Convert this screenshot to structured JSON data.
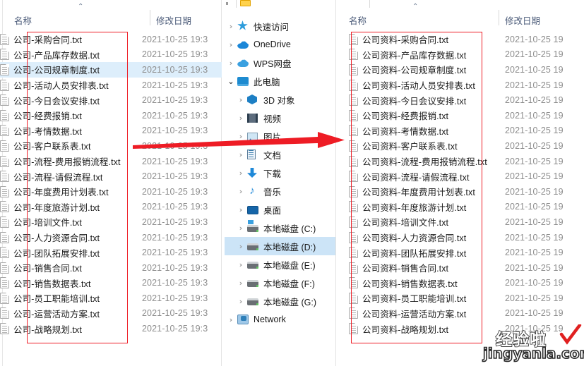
{
  "left_window": {
    "columns": {
      "name": "名称",
      "date": "修改日期",
      "sort_caret": "⌃"
    },
    "prefix": "公司-",
    "date_value": "2021-10-25 19:3",
    "selected_index": 2,
    "files": [
      "公司-采购合同.txt",
      "公司-产品库存数据.txt",
      "公司-公司规章制度.txt",
      "公司-活动人员安排表.txt",
      "公司-今日会议安排.txt",
      "公司-经费报销.txt",
      "公司-考情数据.txt",
      "公司-客户联系表.txt",
      "公司-流程-费用报销流程.txt",
      "公司-流程-请假流程.txt",
      "公司-年度费用计划表.txt",
      "公司-年度旅游计划.txt",
      "公司-培训文件.txt",
      "公司-人力资源合同.txt",
      "公司-团队拓展安排.txt",
      "公司-销售合同.txt",
      "公司-销售数据表.txt",
      "公司-员工职能培训.txt",
      "公司-运营活动方案.txt",
      "公司-战略规划.txt"
    ]
  },
  "right_window": {
    "columns": {
      "name": "名称",
      "date": "修改日期",
      "sort_caret": "⌃"
    },
    "prefix": "公司资料-",
    "date_value": "2021-10-25 19",
    "files": [
      "公司资料-采购合同.txt",
      "公司资料-产品库存数据.txt",
      "公司资料-公司规章制度.txt",
      "公司资料-活动人员安排表.txt",
      "公司资料-今日会议安排.txt",
      "公司资料-经费报销.txt",
      "公司资料-考情数据.txt",
      "公司资料-客户联系表.txt",
      "公司资料-流程-费用报销流程.txt",
      "公司资料-流程-请假流程.txt",
      "公司资料-年度费用计划表.txt",
      "公司资料-年度旅游计划.txt",
      "公司资料-培训文件.txt",
      "公司资料-人力资源合同.txt",
      "公司资料-团队拓展安排.txt",
      "公司资料-销售合同.txt",
      "公司资料-销售数据表.txt",
      "公司资料-员工职能培训.txt",
      "公司资料-运营活动方案.txt",
      "公司资料-战略规划.txt"
    ]
  },
  "nav_tree": {
    "selected_index": 12,
    "items": [
      {
        "label": "快速访问",
        "icon": "star-icon",
        "indent": 0,
        "chevron": "collapsed"
      },
      {
        "label": "OneDrive",
        "icon": "onedrive-cloud-icon",
        "indent": 0,
        "chevron": "collapsed"
      },
      {
        "label": "WPS网盘",
        "icon": "wps-cloud-icon",
        "indent": 0,
        "chevron": "collapsed"
      },
      {
        "label": "此电脑",
        "icon": "this-pc-icon",
        "indent": 0,
        "chevron": "expanded"
      },
      {
        "label": "3D 对象",
        "icon": "3d-objects-icon",
        "indent": 1,
        "chevron": "collapsed"
      },
      {
        "label": "视频",
        "icon": "videos-icon",
        "indent": 1,
        "chevron": "collapsed"
      },
      {
        "label": "图片",
        "icon": "pictures-icon",
        "indent": 1,
        "chevron": "collapsed"
      },
      {
        "label": "文档",
        "icon": "documents-icon",
        "indent": 1,
        "chevron": "collapsed"
      },
      {
        "label": "下载",
        "icon": "downloads-icon",
        "indent": 1,
        "chevron": "collapsed"
      },
      {
        "label": "音乐",
        "icon": "music-icon",
        "indent": 1,
        "chevron": "collapsed"
      },
      {
        "label": "桌面",
        "icon": "desktop-icon",
        "indent": 1,
        "chevron": "collapsed"
      },
      {
        "label": "本地磁盘 (C:)",
        "icon": "system-drive-icon",
        "indent": 1,
        "chevron": "collapsed"
      },
      {
        "label": "本地磁盘 (D:)",
        "icon": "drive-icon",
        "indent": 1,
        "chevron": "collapsed"
      },
      {
        "label": "本地磁盘 (E:)",
        "icon": "drive-icon",
        "indent": 1,
        "chevron": "collapsed"
      },
      {
        "label": "本地磁盘 (F:)",
        "icon": "drive-icon",
        "indent": 1,
        "chevron": "collapsed"
      },
      {
        "label": "本地磁盘 (G:)",
        "icon": "drive-icon",
        "indent": 1,
        "chevron": "collapsed"
      },
      {
        "label": "Network",
        "icon": "network-icon",
        "indent": 0,
        "chevron": "collapsed"
      }
    ]
  },
  "annotations": {
    "arrow_color": "#ee1c25",
    "box_color": "#ee1c25"
  },
  "watermark": {
    "cn": "经验啦",
    "en": "jingyanla.com",
    "check_color": "#e02020"
  }
}
